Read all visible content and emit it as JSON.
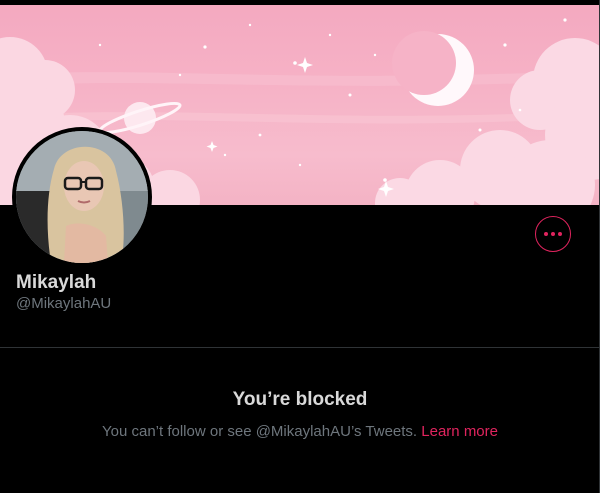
{
  "profile": {
    "name": "Mikaylah",
    "handle": "@MikaylahAU"
  },
  "actions": {
    "more_icon": "more-horizontal-icon"
  },
  "blocked": {
    "title": "You’re blocked",
    "message": "You can’t follow or see @MikaylahAU’s Tweets.",
    "learn_more": "Learn more"
  },
  "colors": {
    "accent": "#e0245e",
    "background": "#000000",
    "primary_text": "#d9d9d9",
    "secondary_text": "#6e767d",
    "divider": "#2f3336"
  }
}
